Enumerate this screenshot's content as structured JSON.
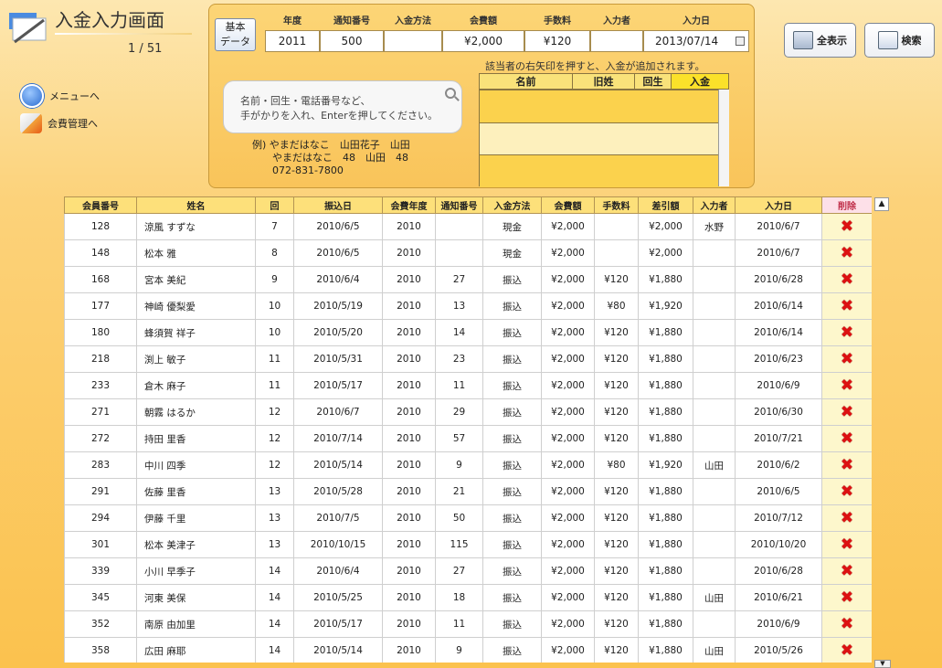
{
  "header": {
    "title": "入金入力画面",
    "page_counter": "1 / 51"
  },
  "nav": {
    "menu_label": "メニューへ",
    "member_label": "会費管理へ"
  },
  "basic_data": {
    "label": "基本\nデータ"
  },
  "entry": {
    "labels": [
      "年度",
      "通知番号",
      "入金方法",
      "会費額",
      "手数料",
      "入力者",
      "入力日"
    ],
    "values": [
      "2011",
      "500",
      "",
      "¥2,000",
      "¥120",
      "",
      "2013/07/14"
    ]
  },
  "hint": "該当者の右矢印を押すと、入金が追加されます。",
  "search": {
    "placeholder_line1": "名前・回生・電話番号など、",
    "placeholder_line2": "手がかりを入れ、Enterを押してください。",
    "example": "例) やまだはなこ　山田花子　山田\n　　やまだはなこ　48　山田　48\n　　072-831-7800"
  },
  "results": {
    "columns": [
      "名前",
      "旧姓",
      "回生",
      "入金"
    ]
  },
  "toolbar": {
    "show_all": "全表示",
    "search": "検索"
  },
  "table": {
    "columns": [
      "会員番号",
      "姓名",
      "回",
      "振込日",
      "会費年度",
      "通知番号",
      "入金方法",
      "会費額",
      "手数料",
      "差引額",
      "入力者",
      "入力日",
      "削除"
    ],
    "rows": [
      [
        "128",
        "涼風 すずな",
        "7",
        "2010/6/5",
        "2010",
        "",
        "現金",
        "¥2,000",
        "",
        "¥2,000",
        "水野",
        "2010/6/7"
      ],
      [
        "148",
        "松本 雅",
        "8",
        "2010/6/5",
        "2010",
        "",
        "現金",
        "¥2,000",
        "",
        "¥2,000",
        "",
        "2010/6/7"
      ],
      [
        "168",
        "宮本 美紀",
        "9",
        "2010/6/4",
        "2010",
        "27",
        "振込",
        "¥2,000",
        "¥120",
        "¥1,880",
        "",
        "2010/6/28"
      ],
      [
        "177",
        "神崎 優梨愛",
        "10",
        "2010/5/19",
        "2010",
        "13",
        "振込",
        "¥2,000",
        "¥80",
        "¥1,920",
        "",
        "2010/6/14"
      ],
      [
        "180",
        "蜂須賀 祥子",
        "10",
        "2010/5/20",
        "2010",
        "14",
        "振込",
        "¥2,000",
        "¥120",
        "¥1,880",
        "",
        "2010/6/14"
      ],
      [
        "218",
        "渕上 敏子",
        "11",
        "2010/5/31",
        "2010",
        "23",
        "振込",
        "¥2,000",
        "¥120",
        "¥1,880",
        "",
        "2010/6/23"
      ],
      [
        "233",
        "倉木 麻子",
        "11",
        "2010/5/17",
        "2010",
        "11",
        "振込",
        "¥2,000",
        "¥120",
        "¥1,880",
        "",
        "2010/6/9"
      ],
      [
        "271",
        "朝霧 はるか",
        "12",
        "2010/6/7",
        "2010",
        "29",
        "振込",
        "¥2,000",
        "¥120",
        "¥1,880",
        "",
        "2010/6/30"
      ],
      [
        "272",
        "持田 里香",
        "12",
        "2010/7/14",
        "2010",
        "57",
        "振込",
        "¥2,000",
        "¥120",
        "¥1,880",
        "",
        "2010/7/21"
      ],
      [
        "283",
        "中川 四季",
        "12",
        "2010/5/14",
        "2010",
        "9",
        "振込",
        "¥2,000",
        "¥80",
        "¥1,920",
        "山田",
        "2010/6/2"
      ],
      [
        "291",
        "佐藤 里香",
        "13",
        "2010/5/28",
        "2010",
        "21",
        "振込",
        "¥2,000",
        "¥120",
        "¥1,880",
        "",
        "2010/6/5"
      ],
      [
        "294",
        "伊藤 千里",
        "13",
        "2010/7/5",
        "2010",
        "50",
        "振込",
        "¥2,000",
        "¥120",
        "¥1,880",
        "",
        "2010/7/12"
      ],
      [
        "301",
        "松本 美津子",
        "13",
        "2010/10/15",
        "2010",
        "115",
        "振込",
        "¥2,000",
        "¥120",
        "¥1,880",
        "",
        "2010/10/20"
      ],
      [
        "339",
        "小川 早季子",
        "14",
        "2010/6/4",
        "2010",
        "27",
        "振込",
        "¥2,000",
        "¥120",
        "¥1,880",
        "",
        "2010/6/28"
      ],
      [
        "345",
        "河東 美保",
        "14",
        "2010/5/25",
        "2010",
        "18",
        "振込",
        "¥2,000",
        "¥120",
        "¥1,880",
        "山田",
        "2010/6/21"
      ],
      [
        "352",
        "南原 由加里",
        "14",
        "2010/5/17",
        "2010",
        "11",
        "振込",
        "¥2,000",
        "¥120",
        "¥1,880",
        "",
        "2010/6/9"
      ],
      [
        "358",
        "広田 麻耶",
        "14",
        "2010/5/14",
        "2010",
        "9",
        "振込",
        "¥2,000",
        "¥120",
        "¥1,880",
        "山田",
        "2010/5/26"
      ]
    ],
    "delete_glyph": "✖"
  },
  "colors": {
    "panel": "#fcd576",
    "header_cell": "#fde07a",
    "delete": "#d11111"
  },
  "icons": {
    "menu": "home-icon",
    "member": "chart-icon",
    "search": "magnifier-icon",
    "delete": "x-icon"
  }
}
